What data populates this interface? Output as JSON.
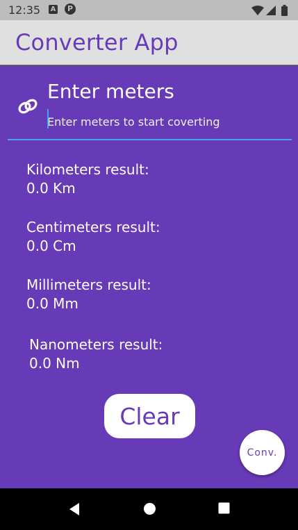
{
  "status_bar": {
    "time": "12:35",
    "notification_a": "A",
    "notification_p": "P"
  },
  "app_bar": {
    "title": "Converter App"
  },
  "input": {
    "label": "Enter meters",
    "placeholder": "Enter meters to start coverting",
    "icon": "link-icon"
  },
  "results": [
    {
      "label": "Kilometers result:",
      "value": "0.0  Km"
    },
    {
      "label": "Centimeters result:",
      "value": "0.0  Cm"
    },
    {
      "label": "Millimeters result:",
      "value": "0.0  Mm"
    },
    {
      "label": "Nanometers result:",
      "value": "0.0  Nm"
    }
  ],
  "buttons": {
    "clear_label": "Clear",
    "convert_label": "Conv."
  },
  "colors": {
    "primary": "#673ab7",
    "app_bar": "#e0e0e0",
    "accent": "#42a5f5",
    "status_bar": "#bdbdbd",
    "nav_bar": "#000000"
  },
  "nav_bar": {
    "icons": [
      "back-icon",
      "home-icon",
      "recents-icon"
    ]
  }
}
